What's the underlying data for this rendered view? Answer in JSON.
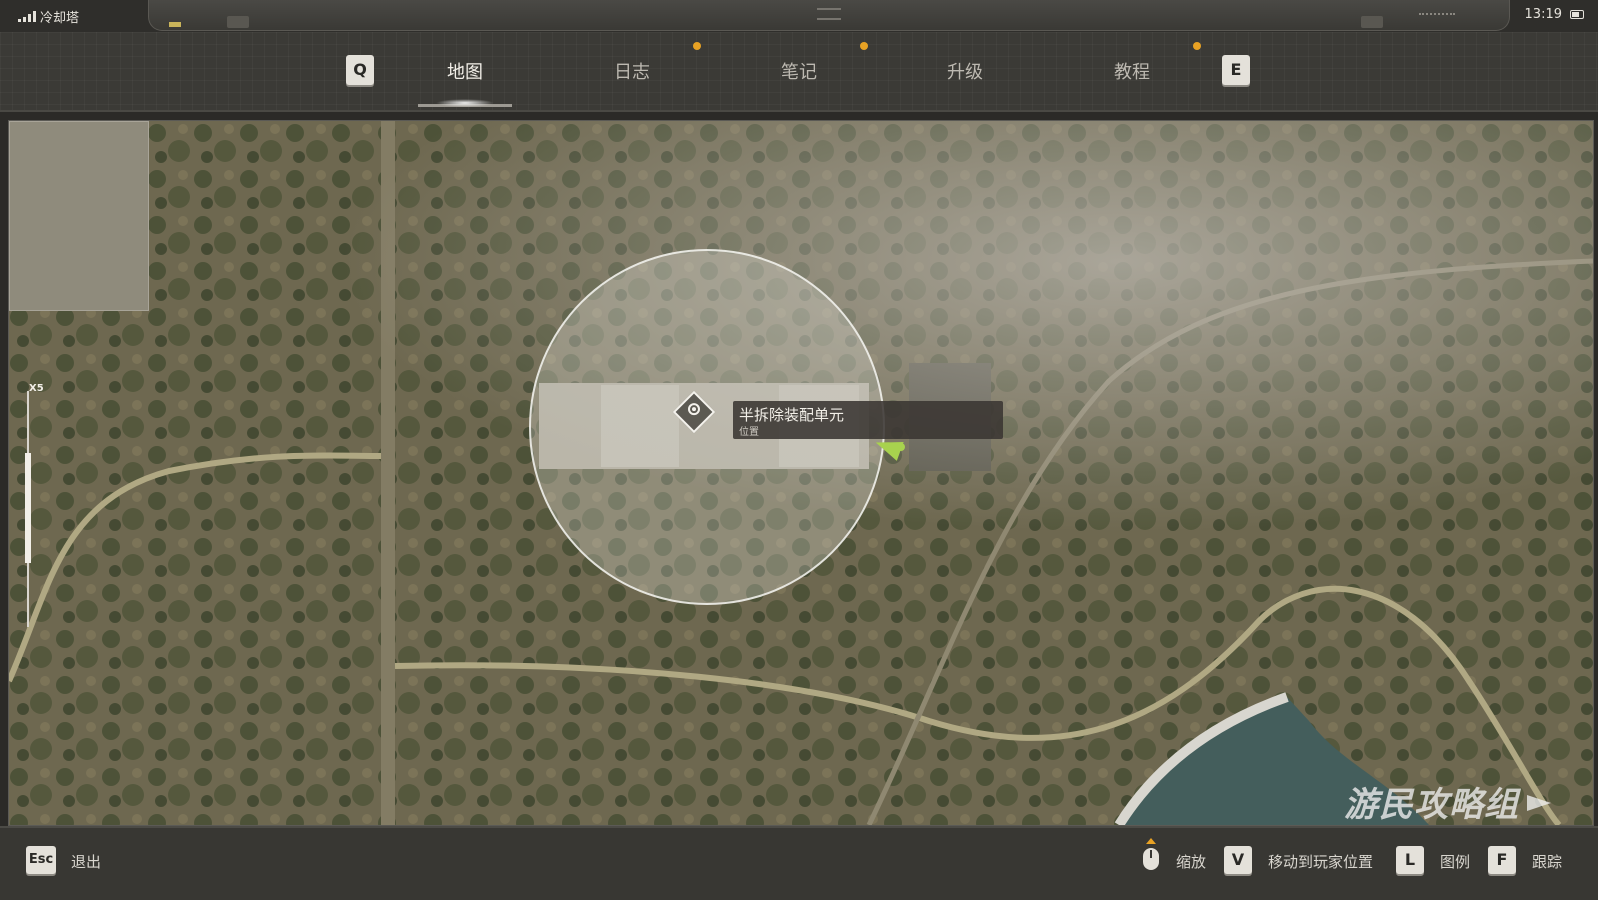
{
  "status": {
    "carrier": "冷却塔",
    "time": "13:19"
  },
  "tabs": {
    "prev_key": "Q",
    "next_key": "E",
    "items": [
      {
        "label": "地图",
        "active": true,
        "notification": false
      },
      {
        "label": "日志",
        "active": false,
        "notification": true
      },
      {
        "label": "笔记",
        "active": false,
        "notification": true
      },
      {
        "label": "升级",
        "active": false,
        "notification": false
      },
      {
        "label": "教程",
        "active": false,
        "notification": true
      }
    ]
  },
  "map": {
    "zoom_label": "X5",
    "marker": {
      "title": "半拆除装配单元",
      "subtitle": "位置",
      "icon": "waypoint-diamond-icon"
    },
    "player_icon": "player-arrow-icon",
    "player_color": "#a8d24e",
    "watermark": "游民攻略组"
  },
  "footer": {
    "exit_key": "Esc",
    "exit_label": "退出",
    "zoom_icon": "mouse-wheel-icon",
    "zoom_label": "缩放",
    "move_key": "V",
    "move_label": "移动到玩家位置",
    "legend_key": "L",
    "legend_label": "图例",
    "track_key": "F",
    "track_label": "跟踪"
  },
  "colors": {
    "accent_dot": "#e8a224",
    "background": "#2b2a27"
  }
}
